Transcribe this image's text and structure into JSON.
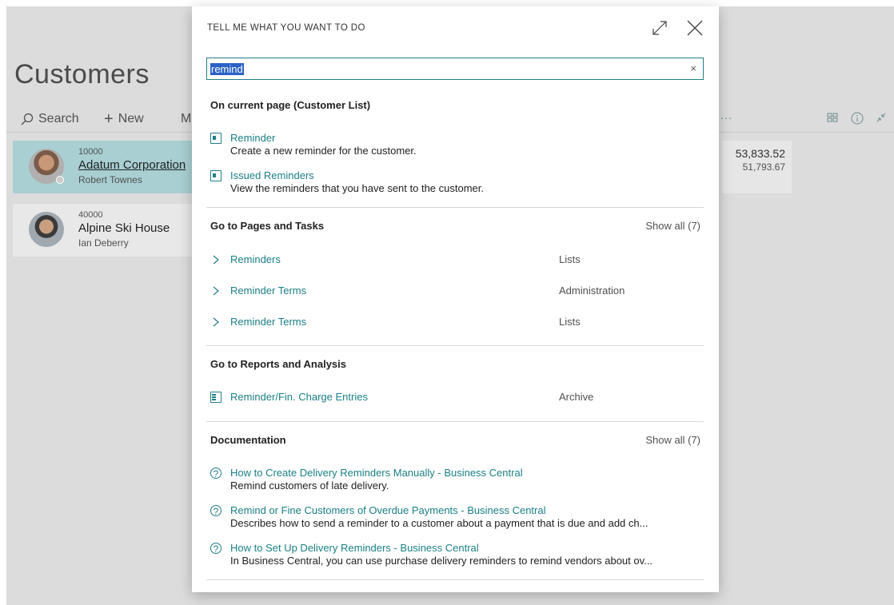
{
  "page": {
    "title": "Customers",
    "actions": {
      "search": "Search",
      "new": "New",
      "more": "M",
      "dots": "…"
    },
    "customers": [
      {
        "number": "10000",
        "name": "Adatum Corporation",
        "contact": "Robert Townes",
        "selected": true
      },
      {
        "number": "40000",
        "name": "Alpine Ski House",
        "contact": "Ian Deberry",
        "selected": false
      }
    ],
    "amounts": {
      "balance": "53,833.52",
      "sales": "51,793.67"
    }
  },
  "dialog": {
    "title": "TELL ME WHAT YOU WANT TO DO",
    "search_value": "remind",
    "sections": {
      "current_page": {
        "heading": "On current page (Customer List)",
        "items": [
          {
            "title": "Reminder",
            "desc": "Create a new reminder for the customer."
          },
          {
            "title": "Issued Reminders",
            "desc": "View the reminders that you have sent to the customer."
          }
        ]
      },
      "pages_tasks": {
        "heading": "Go to Pages and Tasks",
        "show_all": "Show all (7)",
        "items": [
          {
            "title": "Reminders",
            "category": "Lists"
          },
          {
            "title": "Reminder Terms",
            "category": "Administration"
          },
          {
            "title": "Reminder Terms",
            "category": "Lists"
          }
        ]
      },
      "reports": {
        "heading": "Go to Reports and Analysis",
        "items": [
          {
            "title": "Reminder/Fin. Charge Entries",
            "category": "Archive"
          }
        ]
      },
      "documentation": {
        "heading": "Documentation",
        "show_all": "Show all (7)",
        "items": [
          {
            "title": "How to Create Delivery Reminders Manually - Business Central",
            "desc": "Remind customers of late delivery."
          },
          {
            "title": "Remind or Fine Customers of Overdue Payments - Business Central",
            "desc": "Describes how to send a reminder to a customer about a payment that is due and add ch..."
          },
          {
            "title": "How to Set Up Delivery Reminders - Business Central",
            "desc": "In Business Central, you can use purchase delivery reminders to remind vendors about ov..."
          }
        ]
      }
    }
  },
  "colors": {
    "accent": "#1f7f86",
    "selection": "#2b62c7",
    "selected_card": "#a9cfd2"
  }
}
